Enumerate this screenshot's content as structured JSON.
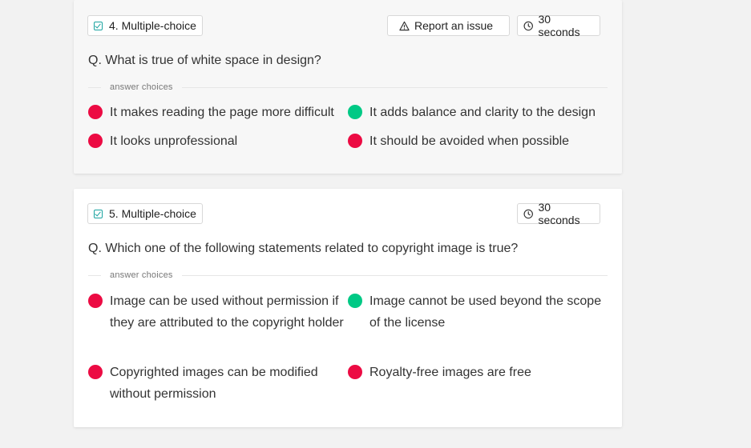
{
  "colors": {
    "correct": "#00c985",
    "incorrect": "#ec0b43",
    "accent": "#1aa3a0"
  },
  "questions": [
    {
      "type_label": "4. Multiple-choice",
      "report_label": "Report an issue",
      "time_label": "30 seconds",
      "question_text": "Q. What is true of white space in design?",
      "answer_choices_label": "answer choices",
      "choices": [
        {
          "text": "It makes reading the page more difficult",
          "correct": false
        },
        {
          "text": "It adds balance and clarity to the design",
          "correct": true
        },
        {
          "text": "It looks unprofessional",
          "correct": false
        },
        {
          "text": "It should be avoided when possible",
          "correct": false
        }
      ]
    },
    {
      "type_label": "5. Multiple-choice",
      "time_label": "30 seconds",
      "question_text": "Q. Which one of the following statements related to copyright image is true?",
      "answer_choices_label": "answer choices",
      "choices": [
        {
          "text": "Image can be used without permission if they are attributed to the copyright holder",
          "correct": false
        },
        {
          "text": "Image cannot be used beyond the scope of the license",
          "correct": true
        },
        {
          "text": "Copyrighted images can be modified without permission",
          "correct": false
        },
        {
          "text": "Royalty-free images are free",
          "correct": false
        }
      ]
    }
  ]
}
